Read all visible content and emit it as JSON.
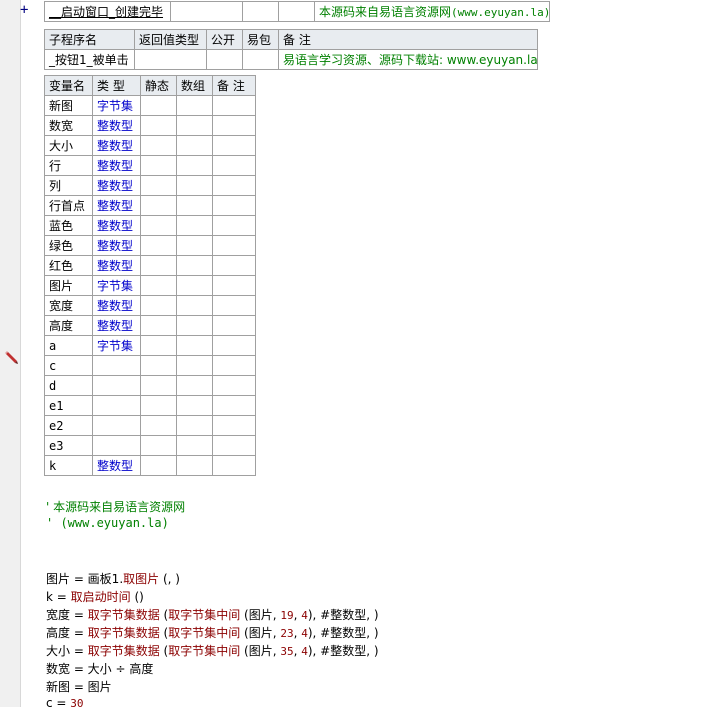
{
  "top_row": {
    "name": "__启动窗口_创建完毕",
    "note": "本源码来自易语言资源网",
    "note_site": "(www.eyuyan.la)"
  },
  "sub_header": {
    "cols": [
      "子程序名",
      "返回值类型",
      "公开",
      "易包",
      "备 注"
    ],
    "name": "_按钮1_被单击",
    "note": "易语言学习资源、源码下载站: www.eyuyan.la"
  },
  "var_table": {
    "cols": [
      "变量名",
      "类 型",
      "静态",
      "数组",
      "备 注"
    ],
    "rows": [
      {
        "name": "新图",
        "type": "字节集"
      },
      {
        "name": "数宽",
        "type": "整数型"
      },
      {
        "name": "大小",
        "type": "整数型"
      },
      {
        "name": "行",
        "type": "整数型"
      },
      {
        "name": "列",
        "type": "整数型"
      },
      {
        "name": "行首点",
        "type": "整数型"
      },
      {
        "name": "蓝色",
        "type": "整数型"
      },
      {
        "name": "绿色",
        "type": "整数型"
      },
      {
        "name": "红色",
        "type": "整数型"
      },
      {
        "name": "图片",
        "type": "字节集"
      },
      {
        "name": "宽度",
        "type": "整数型"
      },
      {
        "name": "高度",
        "type": "整数型"
      },
      {
        "name": "a",
        "type": "字节集"
      },
      {
        "name": "c",
        "type": ""
      },
      {
        "name": "d",
        "type": ""
      },
      {
        "name": "e1",
        "type": ""
      },
      {
        "name": "e2",
        "type": ""
      },
      {
        "name": "e3",
        "type": ""
      },
      {
        "name": "k",
        "type": "整数型"
      }
    ]
  },
  "comments": [
    "' 本源码来自易语言资源网",
    "' (www.eyuyan.la)"
  ],
  "code": {
    "l1": {
      "a": "图片 = 画板1.",
      "f": "取图片",
      "b": " (, )"
    },
    "l2": {
      "a": "k = ",
      "f": "取启动时间",
      "b": " ()"
    },
    "l3": {
      "a": "宽度 = ",
      "f1": "取字节集数据",
      "m1": " (",
      "f2": "取字节集中间",
      "m2": " (图片, ",
      "n1": "19",
      "m3": ", ",
      "n2": "4",
      "m4": "), #整数型, )"
    },
    "l4": {
      "a": "高度 = ",
      "f1": "取字节集数据",
      "m1": " (",
      "f2": "取字节集中间",
      "m2": " (图片, ",
      "n1": "23",
      "m3": ", ",
      "n2": "4",
      "m4": "), #整数型, )"
    },
    "l5": {
      "a": "大小 = ",
      "f1": "取字节集数据",
      "m1": " (",
      "f2": "取字节集中间",
      "m2": " (图片, ",
      "n1": "35",
      "m3": ", ",
      "n2": "4",
      "m4": "), #整数型, )"
    },
    "l6": {
      "a": "数宽 = 大小 ÷ 高度"
    },
    "l7": {
      "a": "新图 = 图片"
    },
    "l8": {
      "a": "c = ",
      "n": "30"
    }
  },
  "icons": {
    "expand": "plus-icon",
    "edit": "pencil-icon"
  }
}
